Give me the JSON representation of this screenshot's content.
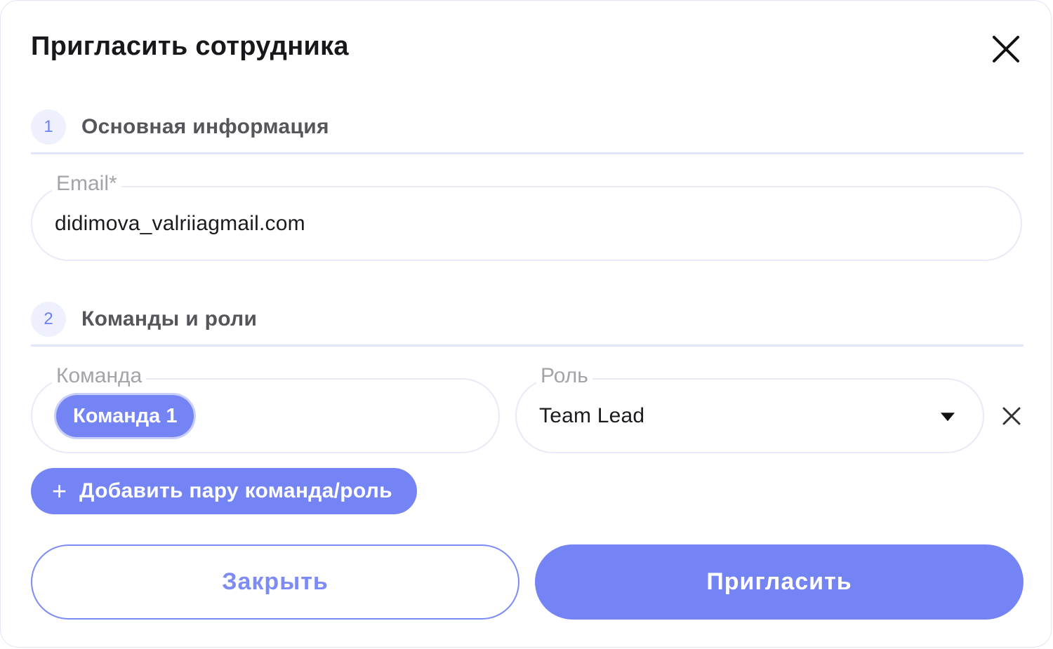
{
  "dialog": {
    "title": "Пригласить сотрудника",
    "close_icon": "close-icon"
  },
  "sections": [
    {
      "number": "1",
      "label": "Основная информация"
    },
    {
      "number": "2",
      "label": "Команды и роли"
    }
  ],
  "email": {
    "label": "Email*",
    "value": "didimova_valriiagmail.com"
  },
  "team": {
    "label": "Команда",
    "selected_chip": "Команда 1"
  },
  "role": {
    "label": "Роль",
    "value": "Team Lead",
    "dropdown_icon": "caret-down-icon"
  },
  "remove_pair_icon": "close-icon",
  "add_pair_button": {
    "icon": "plus-icon",
    "label": "Добавить пару команда/роль"
  },
  "footer": {
    "close_label": "Закрыть",
    "invite_label": "Пригласить"
  },
  "colors": {
    "accent": "#7484f5",
    "accent_outline": "#7d8cf4",
    "step_badge_bg": "#eef0fd",
    "divider": "#e3e6fb",
    "field_border": "#e8eaf7"
  }
}
